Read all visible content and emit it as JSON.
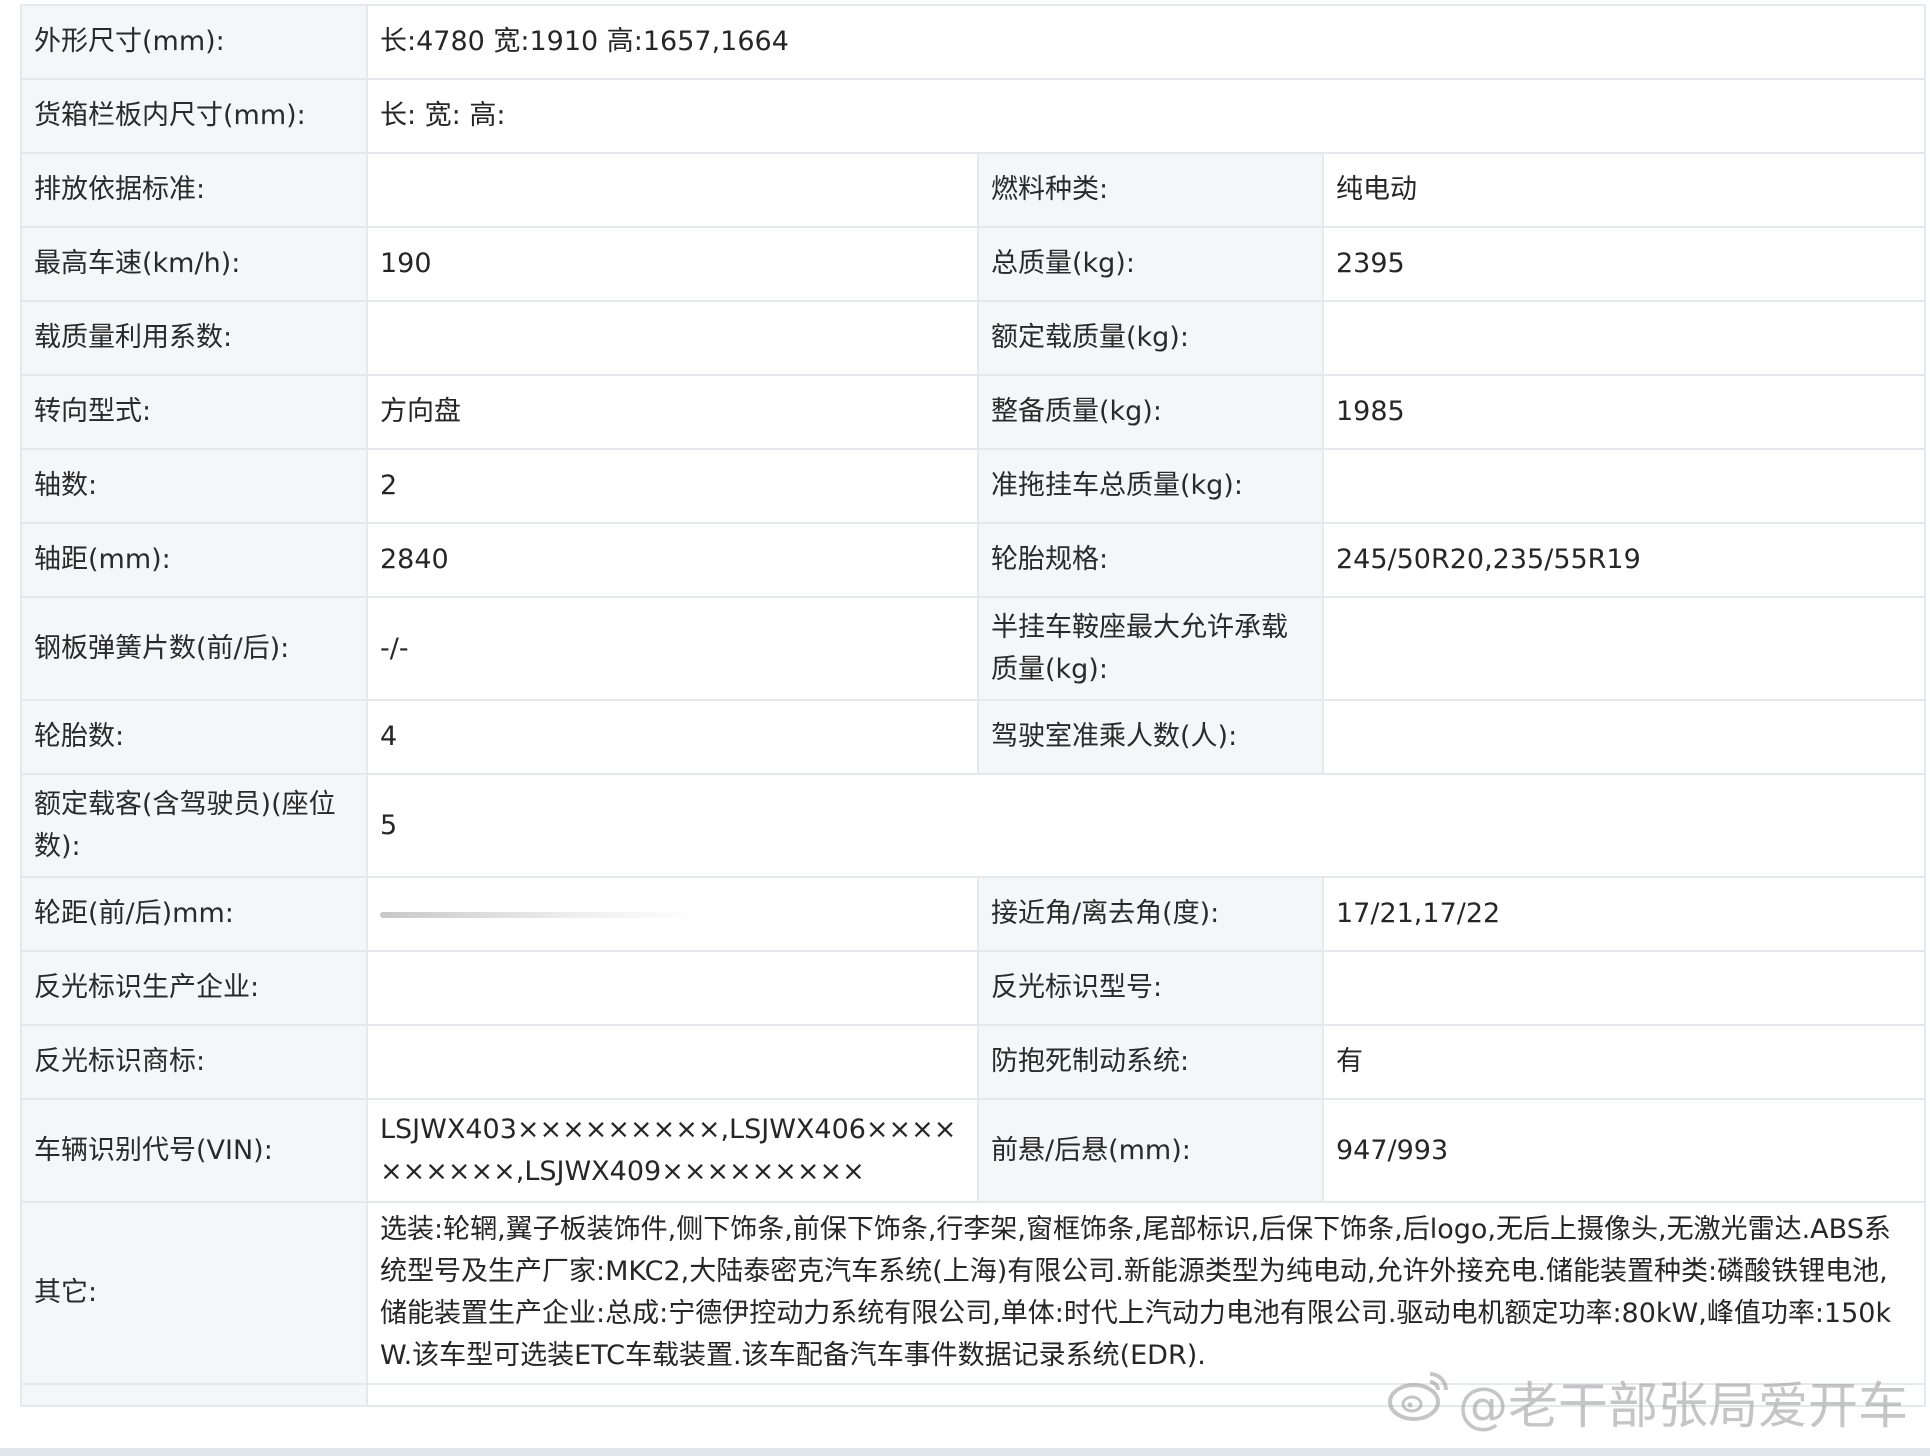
{
  "rows": [
    {
      "l1": "外形尺寸(mm):",
      "v1": "长:4780 宽:1910 高:1657,1664"
    },
    {
      "l1": "货箱栏板内尺寸(mm):",
      "v1": "长:  宽:  高:"
    },
    {
      "l1": "排放依据标准:",
      "v1": "",
      "l2": "燃料种类:",
      "v2": "纯电动"
    },
    {
      "l1": "最高车速(km/h):",
      "v1": "190",
      "l2": "总质量(kg):",
      "v2": "2395"
    },
    {
      "l1": "载质量利用系数:",
      "v1": "",
      "l2": "额定载质量(kg):",
      "v2": ""
    },
    {
      "l1": "转向型式:",
      "v1": "方向盘",
      "l2": "整备质量(kg):",
      "v2": "1985"
    },
    {
      "l1": "轴数:",
      "v1": "2",
      "l2": "准拖挂车总质量(kg):",
      "v2": ""
    },
    {
      "l1": "轴距(mm):",
      "v1": "2840",
      "l2": "轮胎规格:",
      "v2": "245/50R20,235/55R19"
    },
    {
      "l1": "钢板弹簧片数(前/后):",
      "v1": "-/-",
      "l2": "半挂车鞍座最大允许承载质量(kg):",
      "v2": ""
    },
    {
      "l1": "轮胎数:",
      "v1": "4",
      "l2": "驾驶室准乘人数(人):",
      "v2": ""
    },
    {
      "l1": "额定载客(含驾驶员)(座位数):",
      "v1": "5"
    },
    {
      "l1": "轮距(前/后)mm:",
      "v1": "",
      "l2": "接近角/离去角(度):",
      "v2": "17/21,17/22"
    },
    {
      "l1": "反光标识生产企业:",
      "v1": "",
      "l2": "反光标识型号:",
      "v2": ""
    },
    {
      "l1": "反光标识商标:",
      "v1": "",
      "l2": "防抱死制动系统:",
      "v2": "有"
    },
    {
      "l1": "车辆识别代号(VIN):",
      "v1": "LSJWX403×××××××××,LSJWX406××××××××××,LSJWX409×××××××××",
      "l2": "前悬/后悬(mm):",
      "v2": "947/993"
    },
    {
      "l1": "其它:",
      "v1": "选装:轮辋,翼子板装饰件,侧下饰条,前保下饰条,行李架,窗框饰条,尾部标识,后保下饰条,后logo,无后上摄像头,无激光雷达.ABS系统型号及生产厂家:MKC2,大陆泰密克汽车系统(上海)有限公司.新能源类型为纯电动,允许外接充电.储能装置种类:磷酸铁锂电池,储能装置生产企业:总成:宁德伊控动力系统有限公司,单体:时代上汽动力电池有限公司.驱动电机额定功率:80kW,峰值功率:150kW.该车型可选装ETC车载装置.该车配备汽车事件数据记录系统(EDR)."
    }
  ],
  "watermark": "@老干部张局爱开车",
  "icons": {
    "watermark": "weibo-icon"
  }
}
